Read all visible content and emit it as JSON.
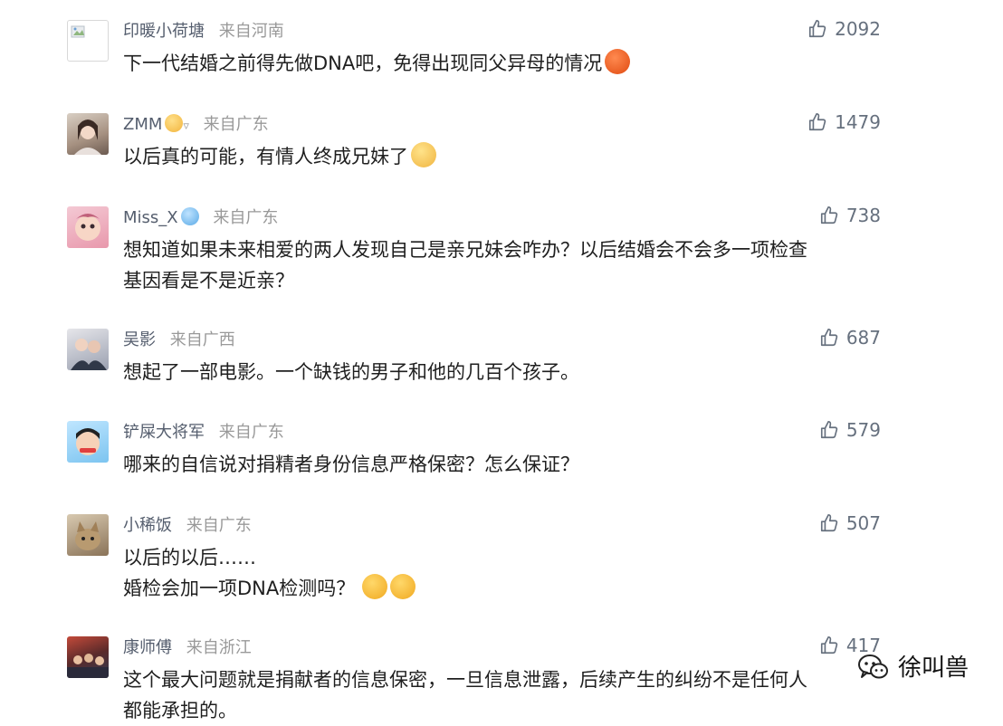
{
  "comments": [
    {
      "username": "印暖小荷塘",
      "location": "来自河南",
      "likes": "2092",
      "lines": [
        "下一代结婚之前得先做DNA吧，免得出现同父异母的情况"
      ],
      "emoji": "angry-emoji-icon",
      "avatar": "broken-image-icon"
    },
    {
      "username": "ZMM",
      "location": "来自广东",
      "likes": "1479",
      "lines": [
        "以后真的可能，有情人终成兄妹了"
      ],
      "emoji": "cat-emoji-icon",
      "avatar": "avatar-photo-woman"
    },
    {
      "username": "Miss_X",
      "location": "来自广东",
      "likes": "738",
      "lines": [
        "想知道如果未来相爱的两人发现自己是亲兄妹会咋办？以后结婚会不会多一项检查",
        "基因看是不是近亲？"
      ],
      "emoji": "",
      "avatar": "avatar-cartoon-pink"
    },
    {
      "username": "吴影",
      "location": "来自广西",
      "likes": "687",
      "lines": [
        "想起了一部电影。一个缺钱的男子和他的几百个孩子。"
      ],
      "emoji": "",
      "avatar": "avatar-photo-couple"
    },
    {
      "username": "铲屎大将军",
      "location": "来自广东",
      "likes": "579",
      "lines": [
        "哪来的自信说对捐精者身份信息严格保密？怎么保证？"
      ],
      "emoji": "",
      "avatar": "avatar-cartoon-boy"
    },
    {
      "username": "小稀饭",
      "location": "来自广东",
      "likes": "507",
      "lines": [
        "以后的以后……",
        "婚检会加一项DNA检测吗？"
      ],
      "emoji": "crying-emoji-icon",
      "avatar": "avatar-photo-cat"
    },
    {
      "username": "康师傅",
      "location": "来自浙江",
      "likes": "417",
      "lines": [
        "这个最大问题就是捐献者的信息保密，一旦信息泄露，后续产生的纠纷不是任何人",
        "都能承担的。"
      ],
      "emoji": "",
      "avatar": "avatar-photo-crowd"
    }
  ],
  "watermark": {
    "text": "徐叫兽",
    "icon": "wechat-icon"
  },
  "colors": {
    "username": "#555e6e",
    "location": "#999999",
    "text": "#1f1f1f",
    "likes": "#66707e"
  }
}
